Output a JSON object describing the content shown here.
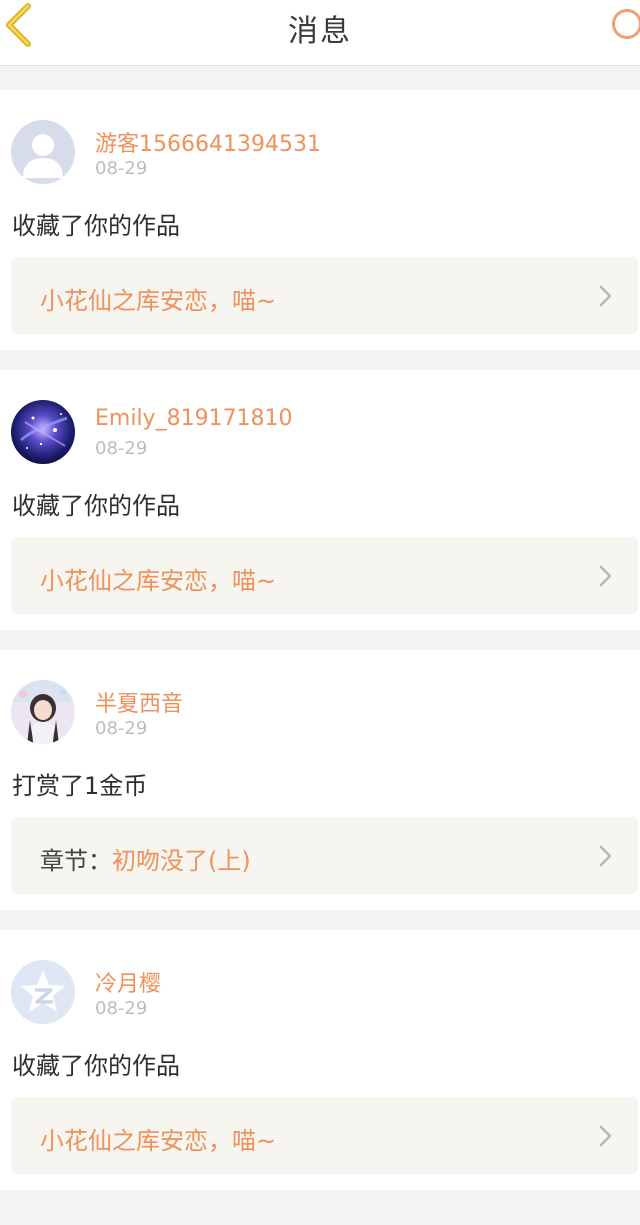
{
  "header": {
    "title": "消息"
  },
  "colors": {
    "accent": "#f0915c",
    "back_icon": "#d9b51e",
    "refresh_icon": "#f0a070"
  },
  "messages": [
    {
      "username": "游客1566641394531",
      "date": "08-29",
      "action": "收藏了你的作品",
      "work_prefix": "",
      "work_title": "小花仙之库安恋，喵~",
      "avatar": "default-person-avatar"
    },
    {
      "username": "Emily_819171810",
      "date": "08-29",
      "action": "收藏了你的作品",
      "work_prefix": "",
      "work_title": "小花仙之库安恋，喵~",
      "avatar": "galaxy-avatar"
    },
    {
      "username": "半夏西音",
      "date": "08-29",
      "action": "打赏了1金币",
      "work_prefix": "章节：",
      "work_title": "初吻没了(上)",
      "avatar": "girl-photo-avatar"
    },
    {
      "username": "冷月樱",
      "date": "08-29",
      "action": "收藏了你的作品",
      "work_prefix": "",
      "work_title": "小花仙之库安恋，喵~",
      "avatar": "qzone-star-avatar"
    }
  ]
}
